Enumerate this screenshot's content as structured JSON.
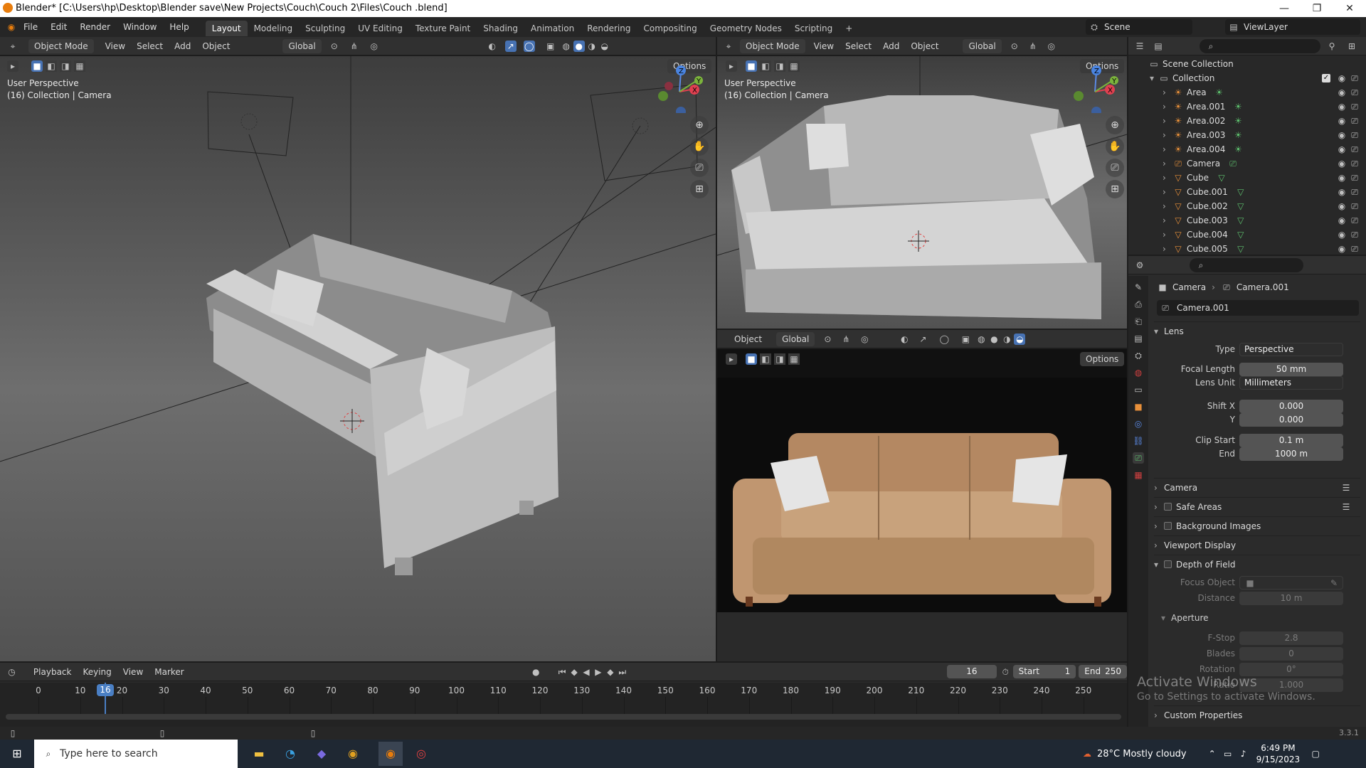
{
  "window": {
    "title": "Blender* [C:\\Users\\hp\\Desktop\\Blender save\\New Projects\\Couch\\Couch 2\\Files\\Couch .blend]",
    "minimize": "—",
    "maximize": "❐",
    "close": "✕"
  },
  "menu": [
    "File",
    "Edit",
    "Render",
    "Window",
    "Help"
  ],
  "workspaces": [
    "Layout",
    "Modeling",
    "Sculpting",
    "UV Editing",
    "Texture Paint",
    "Shading",
    "Animation",
    "Rendering",
    "Compositing",
    "Geometry Nodes",
    "Scripting",
    "+"
  ],
  "scene": {
    "label": "Scene",
    "view_layer": "ViewLayer"
  },
  "vp_left": {
    "mode": "Object Mode",
    "menus": [
      "View",
      "Select",
      "Add",
      "Object"
    ],
    "orientation": "Global",
    "options": "Options",
    "label1": "User Perspective",
    "label2": "(16) Collection | Camera"
  },
  "vp_right": {
    "mode": "Object Mode",
    "menus": [
      "View",
      "Select",
      "Add",
      "Object"
    ],
    "orientation": "Global",
    "options": "Options",
    "label1": "User Perspective",
    "label2": "(16) Collection | Camera"
  },
  "vp_render": {
    "object_menu": "Object",
    "orientation": "Global",
    "options": "Options"
  },
  "outliner": {
    "root": "Scene Collection",
    "collection": "Collection",
    "items": [
      "Area",
      "Area.001",
      "Area.002",
      "Area.003",
      "Area.004",
      "Camera",
      "Cube",
      "Cube.001",
      "Cube.002",
      "Cube.003",
      "Cube.004",
      "Cube.005"
    ]
  },
  "props": {
    "breadcrumb_obj": "Camera",
    "breadcrumb_data": "Camera.001",
    "datablock": "Camera.001",
    "lens": {
      "title": "Lens",
      "type_label": "Type",
      "type_value": "Perspective",
      "focal_label": "Focal Length",
      "focal_value": "50 mm",
      "unit_label": "Lens Unit",
      "unit_value": "Millimeters",
      "shiftx_label": "Shift X",
      "shiftx_value": "0.000",
      "shifty_label": "Y",
      "shifty_value": "0.000",
      "clipstart_label": "Clip Start",
      "clipstart_value": "0.1 m",
      "clipend_label": "End",
      "clipend_value": "1000 m"
    },
    "panels": [
      "Camera",
      "Safe Areas",
      "Background Images",
      "Viewport Display"
    ],
    "dof": {
      "title": "Depth of Field",
      "focus_label": "Focus Object",
      "distance_label": "Distance",
      "distance_value": "10 m",
      "aperture": "Aperture",
      "fstop_label": "F-Stop",
      "fstop_value": "2.8",
      "blades_label": "Blades",
      "blades_value": "0",
      "rotation_label": "Rotation",
      "rotation_value": "0°",
      "ratio_label": "Ratio",
      "ratio_value": "1.000"
    },
    "custom": "Custom Properties"
  },
  "timeline": {
    "menus": [
      "Playback",
      "Keying",
      "View",
      "Marker"
    ],
    "current_frame": "16",
    "start_label": "Start",
    "start_value": "1",
    "end_label": "End",
    "end_value": "250",
    "ticks": [
      "0",
      "10",
      "20",
      "30",
      "40",
      "50",
      "60",
      "70",
      "80",
      "90",
      "100",
      "110",
      "120",
      "130",
      "140",
      "150",
      "160",
      "170",
      "180",
      "190",
      "200",
      "210",
      "220",
      "230",
      "240",
      "250"
    ]
  },
  "watermark": {
    "line1": "Activate Windows",
    "line2": "Go to Settings to activate Windows."
  },
  "version": "3.3.1",
  "taskbar": {
    "search_placeholder": "Type here to search",
    "weather": "28°C  Mostly cloudy",
    "time": "6:49 PM",
    "date": "9/15/2023"
  },
  "colors": {
    "accent": "#4772b3",
    "sofa": "#c8a27c",
    "frame_marker": "#4a7fc4"
  }
}
